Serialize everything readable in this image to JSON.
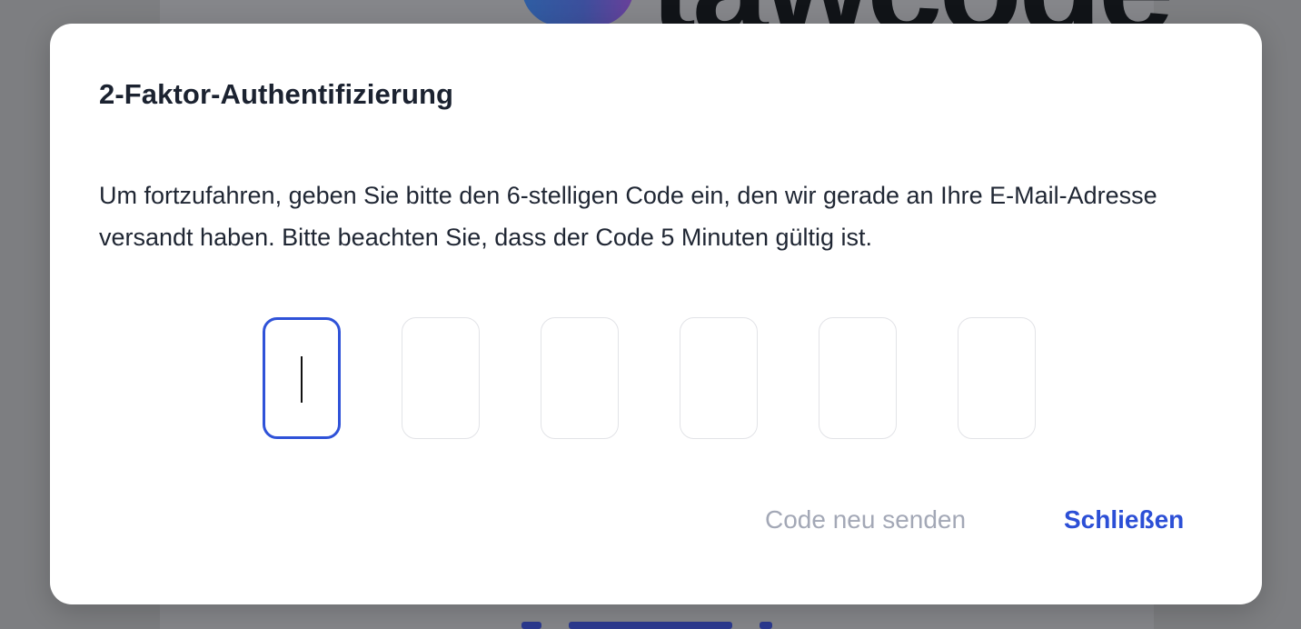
{
  "background": {
    "logo_text": "tawcode"
  },
  "dialog": {
    "title": "2-Faktor-Authentifizierung",
    "description": "Um fortzufahren, geben Sie bitte den 6-stelligen Code ein, den wir gerade an Ihre E-Mail-Adresse versandt haben. Bitte beachten Sie, dass der Code 5 Minuten gültig ist.",
    "code_digits": [
      "",
      "",
      "",
      "",
      "",
      ""
    ],
    "active_digit_index": 0,
    "resend_label": "Code neu senden",
    "close_label": "Schließen"
  },
  "colors": {
    "accent": "#2c4fd6",
    "muted": "#a3a8b6",
    "overlay": "#7d7e81",
    "title": "#1b2230"
  }
}
